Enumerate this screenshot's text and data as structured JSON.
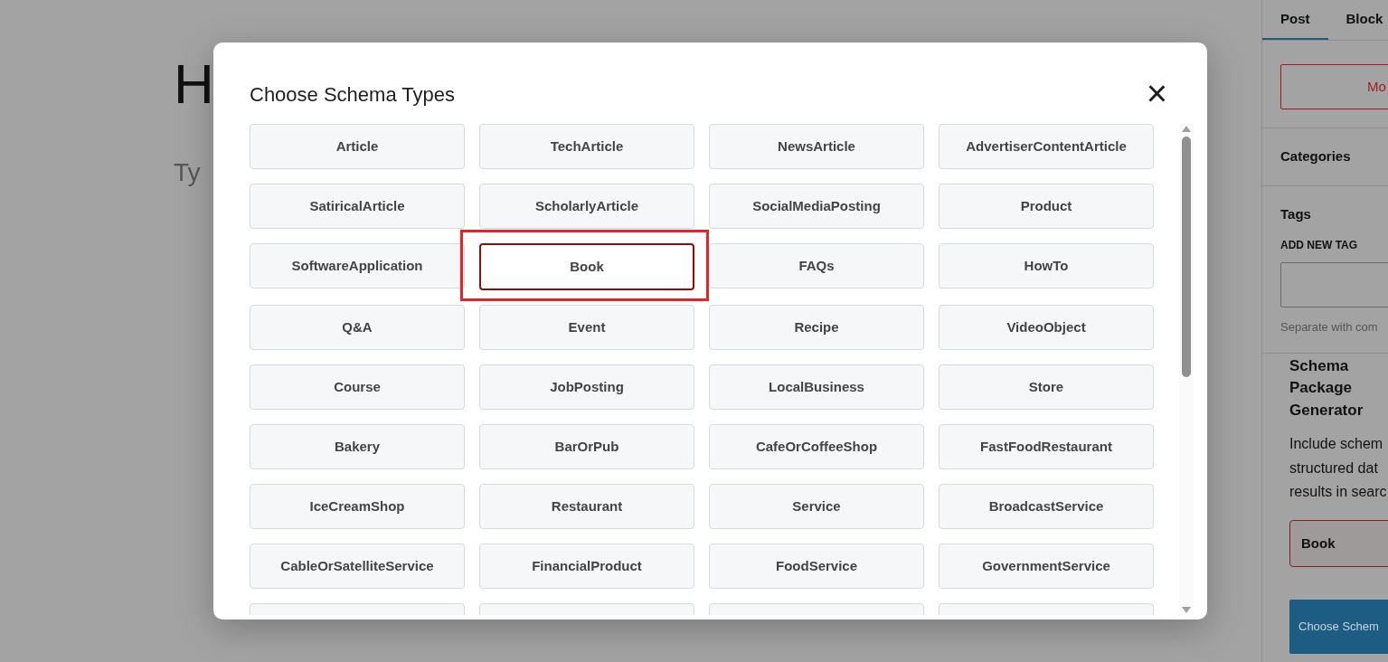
{
  "editor": {
    "title_fragment": "H",
    "body_fragment": "Ty"
  },
  "sidebar": {
    "tabs": [
      {
        "label": "Post",
        "selected": true
      },
      {
        "label": "Block",
        "selected": false
      }
    ],
    "action_button": "Mo",
    "sections": [
      {
        "label": "Categories"
      },
      {
        "label": "Tags"
      }
    ],
    "tag_field": {
      "label": "ADD NEW TAG",
      "help": "Separate with com"
    },
    "schema_panel": {
      "heading": "Schema Package Generator",
      "description_lines": [
        "Include schem",
        "structured dat",
        "results in searc"
      ],
      "selected_type": "Book",
      "choose_button": "Choose Schem"
    }
  },
  "modal": {
    "title": "Choose Schema Types",
    "close": "×",
    "options": [
      {
        "label": "Article",
        "selected": false
      },
      {
        "label": "TechArticle",
        "selected": false
      },
      {
        "label": "NewsArticle",
        "selected": false
      },
      {
        "label": "AdvertiserContentArticle",
        "selected": false
      },
      {
        "label": "SatiricalArticle",
        "selected": false
      },
      {
        "label": "ScholarlyArticle",
        "selected": false
      },
      {
        "label": "SocialMediaPosting",
        "selected": false
      },
      {
        "label": "Product",
        "selected": false
      },
      {
        "label": "SoftwareApplication",
        "selected": false
      },
      {
        "label": "Book",
        "selected": true,
        "highlighted": true
      },
      {
        "label": "FAQs",
        "selected": false
      },
      {
        "label": "HowTo",
        "selected": false
      },
      {
        "label": "Q&A",
        "selected": false
      },
      {
        "label": "Event",
        "selected": false
      },
      {
        "label": "Recipe",
        "selected": false
      },
      {
        "label": "VideoObject",
        "selected": false
      },
      {
        "label": "Course",
        "selected": false
      },
      {
        "label": "JobPosting",
        "selected": false
      },
      {
        "label": "LocalBusiness",
        "selected": false
      },
      {
        "label": "Store",
        "selected": false
      },
      {
        "label": "Bakery",
        "selected": false
      },
      {
        "label": "BarOrPub",
        "selected": false
      },
      {
        "label": "CafeOrCoffeeShop",
        "selected": false
      },
      {
        "label": "FastFoodRestaurant",
        "selected": false
      },
      {
        "label": "IceCreamShop",
        "selected": false
      },
      {
        "label": "Restaurant",
        "selected": false
      },
      {
        "label": "Service",
        "selected": false
      },
      {
        "label": "BroadcastService",
        "selected": false
      },
      {
        "label": "CableOrSatelliteService",
        "selected": false
      },
      {
        "label": "FinancialProduct",
        "selected": false
      },
      {
        "label": "FoodService",
        "selected": false
      },
      {
        "label": "GovernmentService",
        "selected": false
      },
      {
        "kind": "clipped"
      },
      {
        "kind": "clipped"
      },
      {
        "kind": "clipped"
      },
      {
        "kind": "clipped"
      }
    ]
  }
}
